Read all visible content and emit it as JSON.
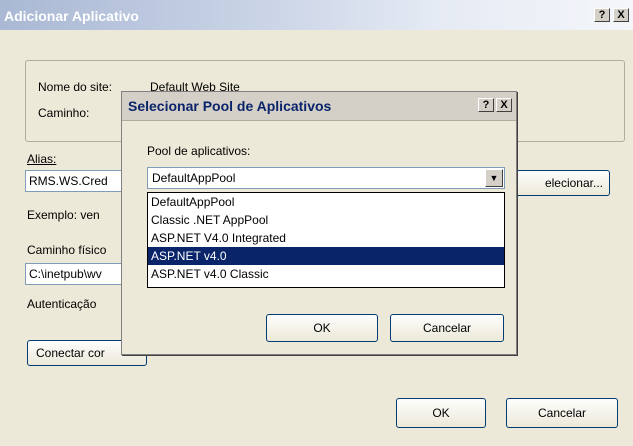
{
  "main_window": {
    "title": "Adicionar Aplicativo",
    "help_button": "?",
    "close_button": "X",
    "site_name_label": "Nome do site:",
    "site_name_value": "Default Web Site",
    "path_label": "Caminho:",
    "alias_label": "Alias:",
    "alias_value": "RMS.WS.Cred",
    "select_button": "elecionar...",
    "example_text": "Exemplo: ven",
    "physical_path_label": "Caminho físico",
    "physical_path_value": "C:\\inetpub\\wv",
    "authentication_label": "Autenticação",
    "connect_button": "Conectar cor",
    "ok_button": "OK",
    "cancel_button": "Cancelar"
  },
  "dialog": {
    "title": "Selecionar Pool de Aplicativos",
    "help_button": "?",
    "close_button": "X",
    "pool_label": "Pool de aplicativos:",
    "selected_value": "DefaultAppPool",
    "options": [
      "DefaultAppPool",
      "Classic .NET AppPool",
      "ASP.NET V4.0 Integrated",
      "ASP.NET v4.0",
      "ASP.NET v4.0 Classic"
    ],
    "highlighted_index": 3,
    "ok_button": "OK",
    "cancel_button": "Cancelar"
  }
}
